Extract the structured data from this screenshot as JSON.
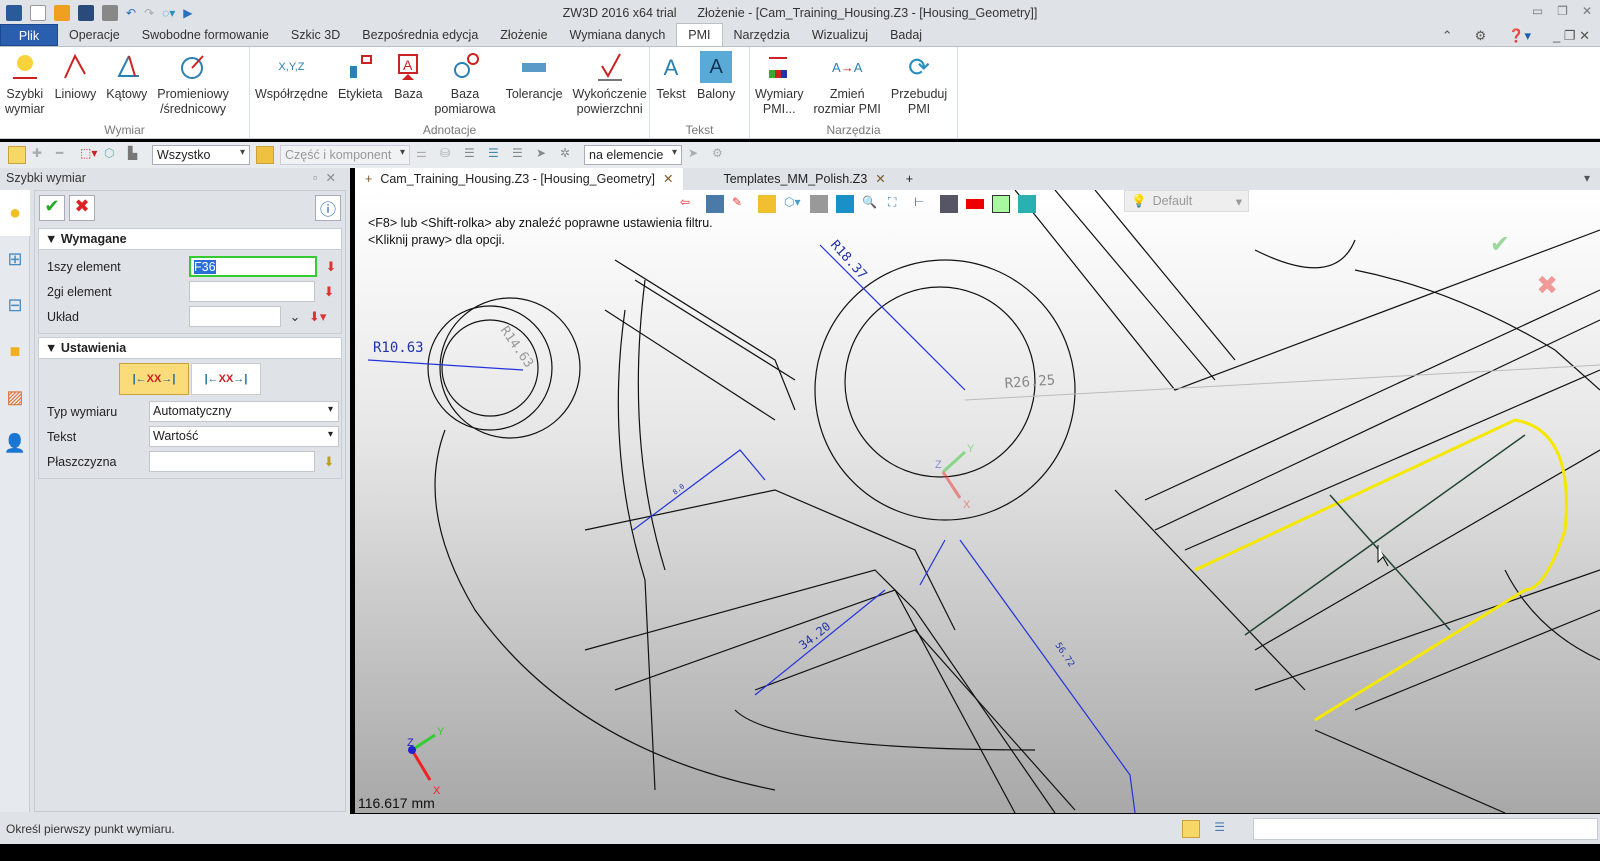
{
  "window": {
    "title_app": "ZW3D 2016  x64 trial",
    "title_doc": "Złożenie - [Cam_Training_Housing.Z3 - [Housing_Geometry]]"
  },
  "menu": {
    "tabs": [
      "Plik",
      "Operacje",
      "Swobodne formowanie",
      "Szkic 3D",
      "Bezpośrednia edycja",
      "Złożenie",
      "Wymiana danych",
      "PMI",
      "Narzędzia",
      "Wizualizuj",
      "Badaj"
    ],
    "active": "PMI"
  },
  "ribbon": {
    "groups": [
      {
        "label": "Wymiar",
        "buttons": [
          "Szybki\nwymiar",
          "Liniowy",
          "Kątowy",
          "Promieniowy\n/średnicowy"
        ]
      },
      {
        "label": "Adnotacje",
        "buttons": [
          "Współrzędne",
          "Etykieta",
          "Baza",
          "Baza\npomiarowa",
          "Tolerancje",
          "Wykończenie\npowierzchni"
        ]
      },
      {
        "label": "Tekst",
        "buttons": [
          "Tekst",
          "Balony"
        ]
      },
      {
        "label": "Narzędzia",
        "buttons": [
          "Wymiary\nPMI...",
          "Zmień\nrozmiar PMI",
          "Przebuduj\nPMI"
        ]
      }
    ]
  },
  "toolbar": {
    "filter": "Wszystko",
    "scope": "Część i komponent",
    "pick_mode": "na elemencie"
  },
  "panel": {
    "title": "Szybki wymiar",
    "required_label": "Wymagane",
    "first_label": "1szy element",
    "first_value": "F36",
    "second_label": "2gi element",
    "second_value": "",
    "layout_label": "Układ",
    "layout_value": "",
    "settings_label": "Ustawienia",
    "style_text": "XX",
    "type_label": "Typ wymiaru",
    "type_value": "Automatyczny",
    "text_label": "Tekst",
    "text_value": "Wartość",
    "plane_label": "Płaszczyzna",
    "plane_value": ""
  },
  "doc_tabs": [
    "Cam_Training_Housing.Z3 - [Housing_Geometry]",
    "Templates_MM_Polish.Z3"
  ],
  "viewport": {
    "hint1": "<F8> lub <Shift-rolka> aby znaleźć poprawne ustawienia filtru.",
    "hint2": "<Kliknij prawy> dla opcji.",
    "render_mode": "Default",
    "scale": "116.617 mm",
    "dims": {
      "r1": "R10.63",
      "r2": "R14.63",
      "r3": "R18.37",
      "r4": "R26.25",
      "l1": "34.20",
      "l2": "56.72",
      "l3": "8.0"
    },
    "axes": {
      "x": "X",
      "y": "Y",
      "z": "Z"
    }
  },
  "status": {
    "message": "Określ pierwszy punkt wymiaru."
  }
}
